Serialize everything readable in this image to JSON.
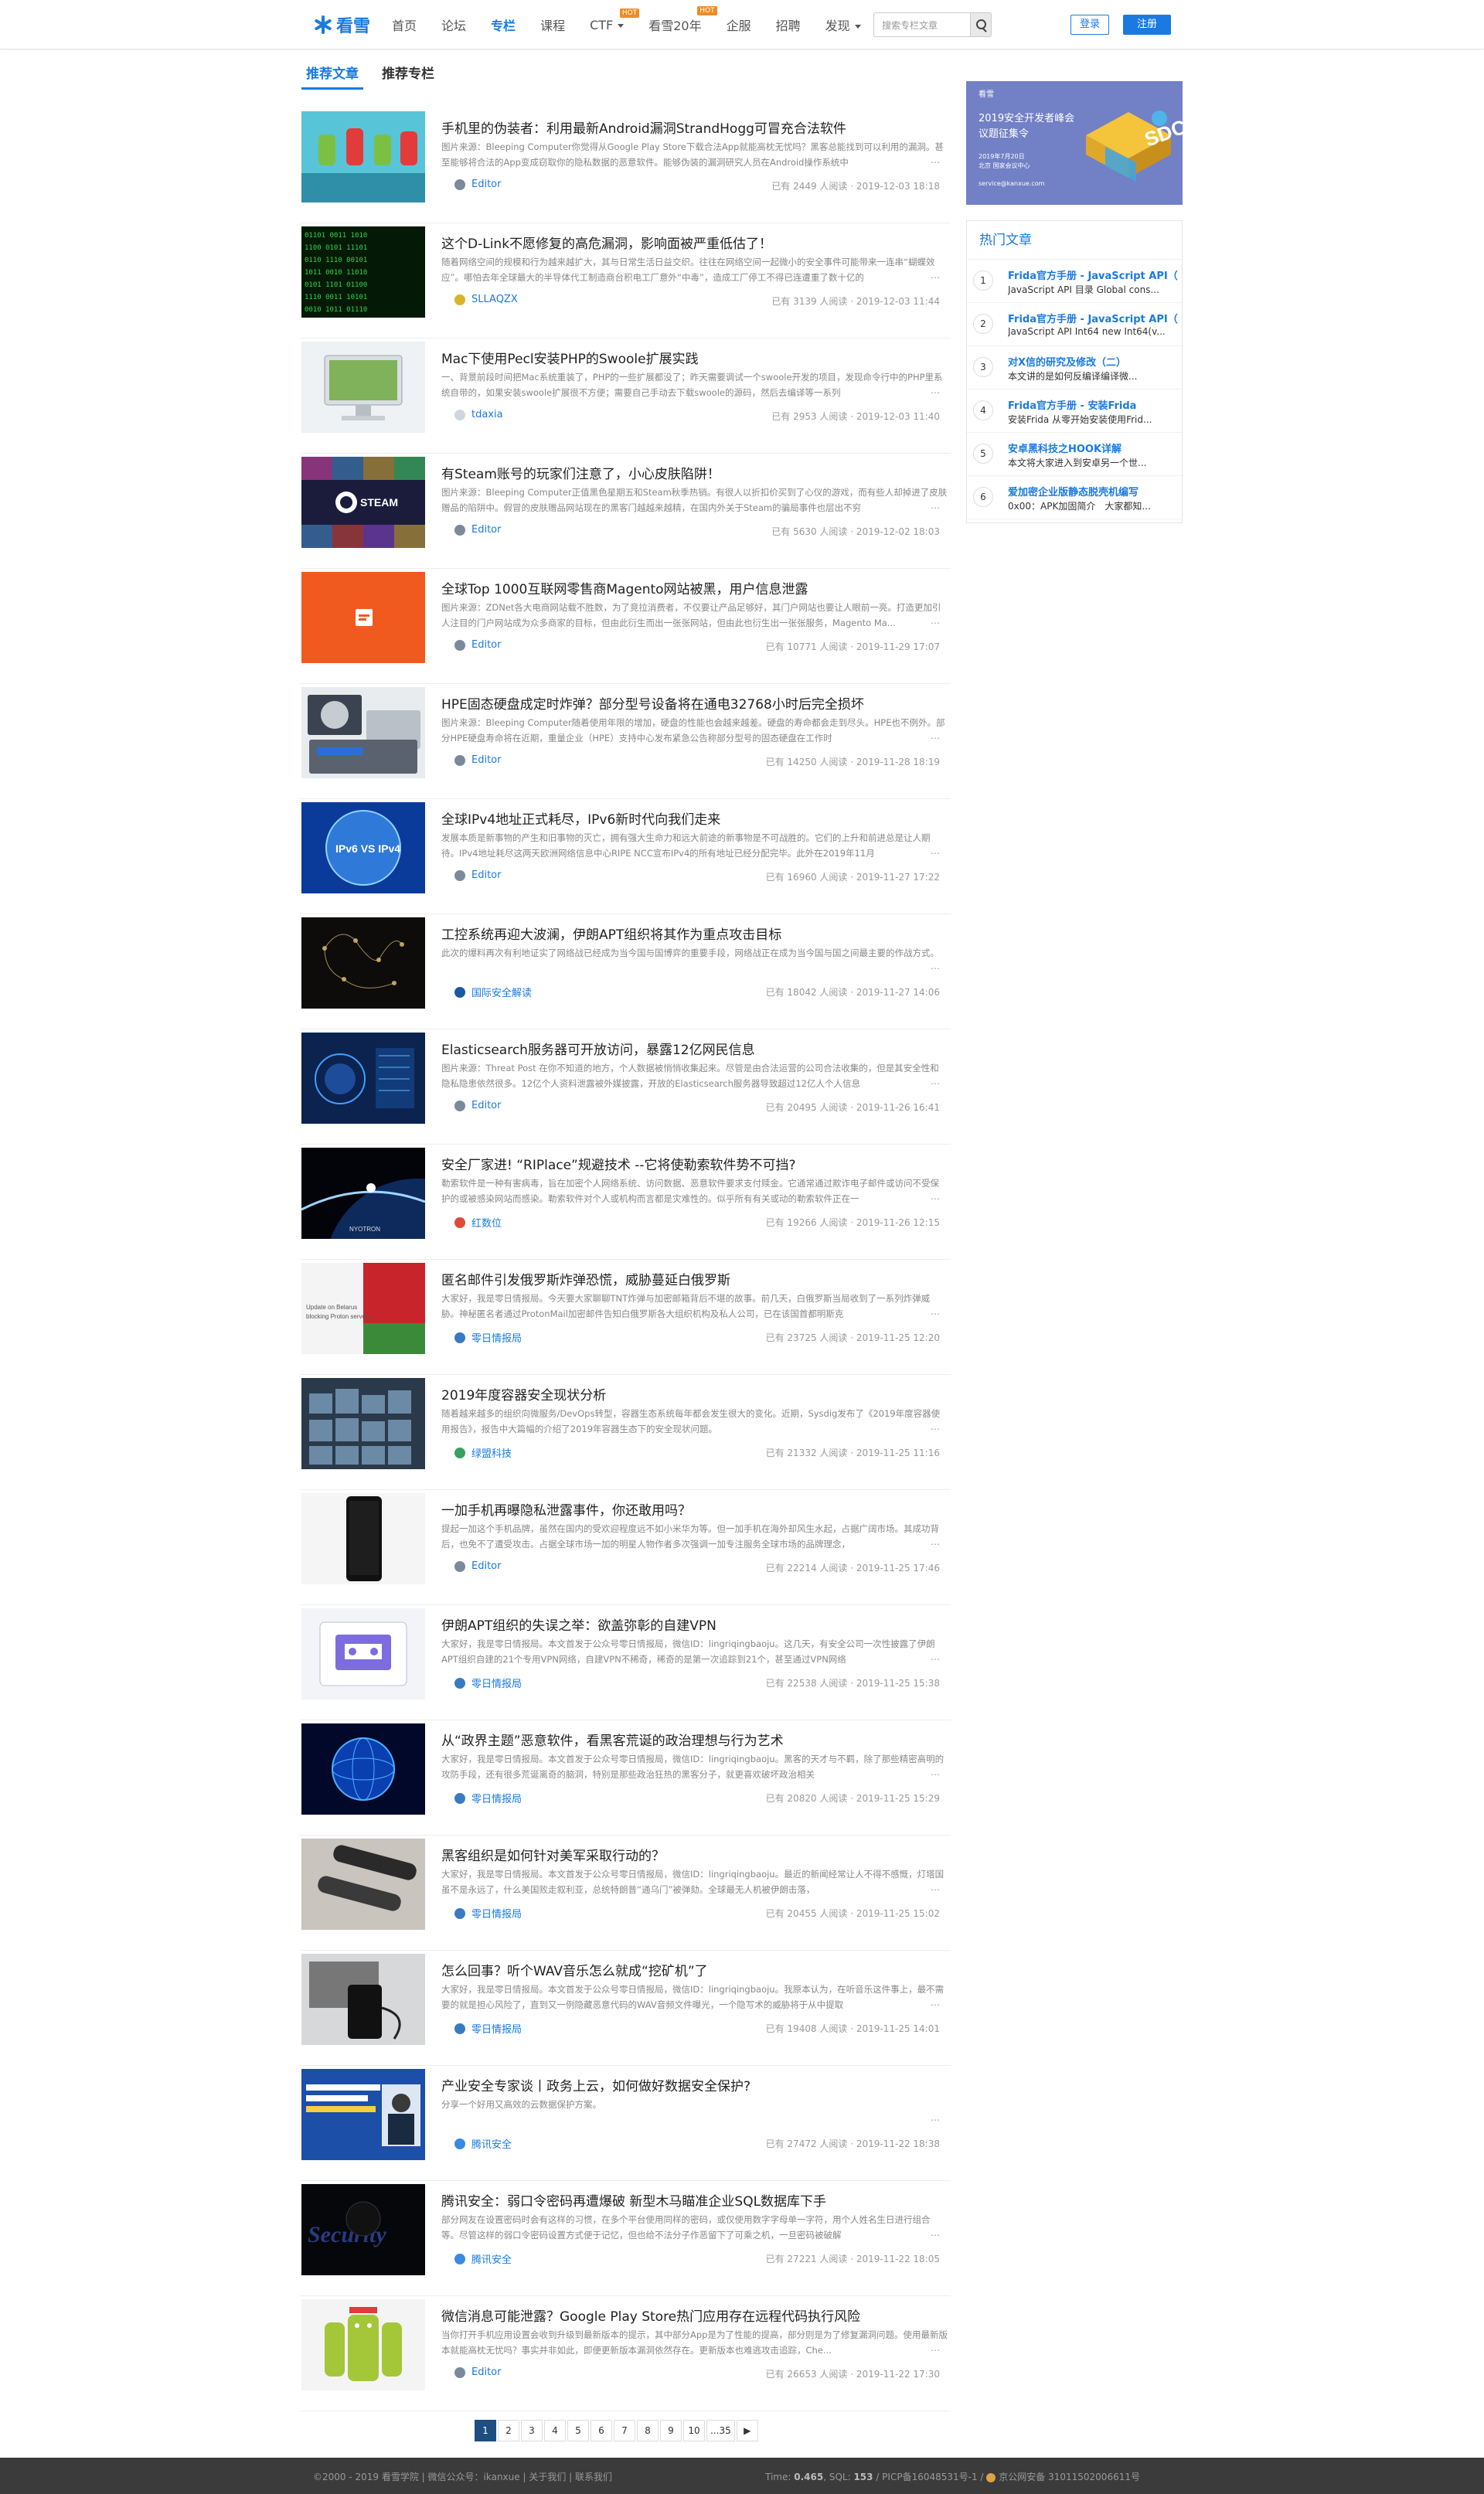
{
  "nav": {
    "logo": "看雪",
    "items": [
      {
        "label": "首页"
      },
      {
        "label": "论坛"
      },
      {
        "label": "专栏",
        "active": true
      },
      {
        "label": "课程"
      },
      {
        "label": "CTF",
        "hot": "HOT",
        "dropdown": true
      },
      {
        "label": "看雪20年",
        "hot": "HOT"
      },
      {
        "label": "企服"
      },
      {
        "label": "招聘"
      },
      {
        "label": "发现",
        "dropdown": true
      }
    ],
    "search_placeholder": "搜索专栏文章",
    "login": "登录",
    "register": "注册"
  },
  "tabs": [
    "推荐文章",
    "推荐专栏"
  ],
  "articles": [
    {
      "title": "手机里的伪装者：利用最新Android漏洞StrandHogg可冒充合法软件",
      "summary": "图片来源：Bleeping Computer你觉得从Google Play Store下载合法App就能高枕无忧吗？黑客总能找到可以利用的漏洞。甚至能够将合法的App变成窃取你的隐私数据的恶意软件。能够伪装的漏洞研究人员在Android操作系统中",
      "author": "Editor",
      "meta": "已有 2449 人阅读 · 2019-12-03 18:18"
    },
    {
      "title": "这个D-Link不愿修复的高危漏洞，影响面被严重低估了！",
      "summary": "随着网络空间的规模和行为越来越扩大，其与日常生活日益交织。往往在网络空间一起微小的安全事件可能带来一连串“蝴蝶效应”。哪怕去年全球最大的半导体代工制造商台积电工厂意外“中毒”，造成工厂停工不得已连遭重了数十亿的",
      "author": "SLLAQZX",
      "meta": "已有 3139 人阅读 · 2019-12-03 11:44"
    },
    {
      "title": "Mac下使用Pecl安装PHP的Swoole扩展实践",
      "summary": "一、背景前段时间把Mac系统重装了，PHP的一些扩展都没了；昨天需要调试一个swoole开发的项目，发现命令行中的PHP里系统自带的，如果安装swoole扩展很不方便；需要自己手动去下载swoole的源码，然后去编译等一系列",
      "author": "tdaxia",
      "meta": "已有 2953 人阅读 · 2019-12-03 11:40"
    },
    {
      "title": "有Steam账号的玩家们注意了，小心皮肤陷阱！",
      "summary": "图片来源：Bleeping Computer正值黑色星期五和Steam秋季热销。有很人以折扣价买到了心仪的游戏，而有些人却掉进了皮肤赠品的陷阱中。假冒的皮肤赠品网站现在的黑客门越越来越精，在国内外关于Steam的骗局事件也层出不穷",
      "author": "Editor",
      "meta": "已有 5630 人阅读 · 2019-12-02 18:03"
    },
    {
      "title": "全球Top 1000互联网零售商Magento网站被黑，用户信息泄露",
      "summary": "图片来源：ZDNet各大电商网站载不胜数，为了竞拉消费者，不仅要让产品足够好，其门户网站也要让人眼前一亮。打造更加引人注目的门户网站成为众多商家的目标，但由此衍生而出一张张网站，但由此也衍生出一张张服务，Magento Ma...",
      "author": "Editor",
      "meta": "已有 10771 人阅读 · 2019-11-29 17:07"
    },
    {
      "title": "HPE固态硬盘成定时炸弹？部分型号设备将在通电32768小时后完全损坏",
      "summary": "图片来源：Bleeping Computer随着使用年限的增加，硬盘的性能也会越来越差。硬盘的寿命都会走到尽头。HPE也不例外。部分HPE硬盘寿命将在近期，重量企业（HPE）支持中心发布紧急公告称部分型号的固态硬盘在工作时",
      "author": "Editor",
      "meta": "已有 14250 人阅读 · 2019-11-28 18:19"
    },
    {
      "title": "全球IPv4地址正式耗尽，IPv6新时代向我们走来",
      "summary": "发展本质是新事物的产生和旧事物的灭亡，拥有强大生命力和远大前途的新事物是不可战胜的。它们的上升和前进总是让人期待。IPv4地址耗尽这两天欧洲网络信息中心RIPE NCC宣布IPv4的所有地址已经分配完毕。此外在2019年11月",
      "author": "Editor",
      "meta": "已有 16960 人阅读 · 2019-11-27 17:22"
    },
    {
      "title": "工控系统再迎大波澜，伊朗APT组织将其作为重点攻击目标",
      "summary": "此次的爆料再次有利地证实了网络战已经成为当今国与国博弈的重要手段，网络战正在成为当今国与国之间最主要的作战方式。",
      "author": "国际安全解读",
      "meta": "已有 18042 人阅读 · 2019-11-27 14:06"
    },
    {
      "title": "Elasticsearch服务器可开放访问，暴露12亿网民信息",
      "summary": "图片来源：Threat Post 在你不知道的地方，个人数据被悄悄收集起来。尽管是由合法运营的公司合法收集的，但是其安全性和隐私隐患依然很多。12亿个人资料泄露被外媒披露，开放的Elasticsearch服务器导致超过12亿人个人信息",
      "author": "Editor",
      "meta": "已有 20495 人阅读 · 2019-11-26 16:41"
    },
    {
      "title": "安全厂家进! “RIPlace”规避技术 --它将使勒索软件势不可挡?",
      "summary": "勒索软件是一种有害病毒，旨在加密个人网络系统、访问数据、恶意软件要求支付赎金。它通常通过欺诈电子邮件或访问不受保护的或被感染网站而感染。勒索软件对个人或机构而言都是灾难性的。似乎所有有关或动的勒索软件正在一",
      "author": "红数位",
      "meta": "已有 19266 人阅读 · 2019-11-26 12:15"
    },
    {
      "title": "匿名邮件引发俄罗斯炸弹恐慌，威胁蔓延白俄罗斯",
      "summary": "大家好，我是零日情报局。今天要大家聊聊TNT炸弹与加密邮箱背后不堪的故事。前几天，白俄罗斯当局收到了一系列炸弹威胁。神秘匿名者通过ProtonMail加密邮件告知白俄罗斯各大组织机构及私人公司，已在该国首都明斯克",
      "author": "零日情报局",
      "meta": "已有 23725 人阅读 · 2019-11-25 12:20"
    },
    {
      "title": "2019年度容器安全现状分析",
      "summary": "随着越来越多的组织向微服务/DevOps转型，容器生态系统每年都会发生很大的变化。近期，Sysdig发布了《2019年度容器使用报告》，报告中大篇幅的介绍了2019年容器生态下的安全现状问题。",
      "author": "绿盟科技",
      "meta": "已有 21332 人阅读 · 2019-11-25 11:16"
    },
    {
      "title": "一加手机再曝隐私泄露事件，你还敢用吗？",
      "summary": "提起一加这个手机品牌，虽然在国内的受欢迎程度远不如小米华为等。但一加手机在海外却风生水起，占据广阔市场。其成功背后，也免不了遭受攻击。占据全球市场一加的明星人物作者多次强调一加专注服务全球市场的品牌理念，",
      "author": "Editor",
      "meta": "已有 22214 人阅读 · 2019-11-25 17:46"
    },
    {
      "title": "伊朗APT组织的失误之举：欲盖弥彰的自建VPN",
      "summary": "大家好，我是零日情报局。本文首发于公众号零日情报局，微信ID：lingriqingbaoju。这几天，有安全公司一次性披露了伊朗APT组织自建的21个专用VPN网络，自建VPN不稀奇，稀奇的是第一次追踪到21个，甚至通过VPN网络",
      "author": "零日情报局",
      "meta": "已有 22538 人阅读 · 2019-11-25 15:38"
    },
    {
      "title": "从“政界主题”恶意软件，看黑客荒诞的政治理想与行为艺术",
      "summary": "大家好，我是零日情报局。本文首发于公众号零日情报局，微信ID：lingriqingbaoju。黑客的天才与不羁，除了那些精密高明的攻防手段，还有很多荒诞离奇的脑洞，特别是那些政治狂热的黑客分子，就更喜欢破坏政治相关",
      "author": "零日情报局",
      "meta": "已有 20820 人阅读 · 2019-11-25 15:29"
    },
    {
      "title": "黑客组织是如何针对美军采取行动的？",
      "summary": "大家好，我是零日情报局。本文首发于公众号零日情报局，微信ID：lingriqingbaoju。最近的新闻经常让人不得不感慨，灯塔国虽不是永远了，什么美国败走叙利亚，总统特朗普“通乌门”被弹劾。全球最无人机被伊朗击落，",
      "author": "零日情报局",
      "meta": "已有 20455 人阅读 · 2019-11-25 15:02"
    },
    {
      "title": "怎么回事？听个WAV音乐怎么就成“挖矿机”了",
      "summary": "大家好，我是零日情报局。本文首发于公众号零日情报局，微信ID：lingriqingbaoju。我原本认为，在听音乐这件事上，最不需要的就是担心风险了，直到又一例隐藏恶意代码的WAV音频文件曝光，一个隐写术的威胁将于从中提取",
      "author": "零日情报局",
      "meta": "已有 19408 人阅读 · 2019-11-25 14:01"
    },
    {
      "title": "产业安全专家谈丨政务上云，如何做好数据安全保护?",
      "summary": "分享一个好用又高效的云数据保护方案。",
      "author": "腾讯安全",
      "meta": "已有 27472 人阅读 · 2019-11-22 18:38"
    },
    {
      "title": "腾讯安全：弱口令密码再遭爆破 新型木马瞄准企业SQL数据库下手",
      "summary": "部分网友在设置密码时会有这样的习惯，在多个平台使用同样的密码，或仅使用数字字母单一字符，用个人姓名生日进行组合等。尽管这样的弱口令密码设置方式便于记忆，但也给不法分子作恶留下了可乘之机，一旦密码被破解",
      "author": "腾讯安全",
      "meta": "已有 27221 人阅读 · 2019-11-22 18:05"
    },
    {
      "title": "微信消息可能泄露？Google Play Store热门应用存在远程代码执行风险",
      "summary": "当你打开手机应用设置会收到升级到最新版本的提示，其中部分App是为了性能的提高，部分则是为了修复漏洞问题。使用最新版本就能高枕无忧吗？事实并非如此，即便更新版本漏洞依然存在。更新版本也难逃攻击追踪，Che...",
      "author": "Editor",
      "meta": "已有 26653 人阅读 · 2019-11-22 17:30"
    }
  ],
  "sidebar": {
    "banner": {
      "brand": "看雪",
      "title_line1": "2019安全开发者峰会",
      "title_line2": "议题征集令",
      "date": "2019年7月20日",
      "place": "北京 国家会议中心",
      "email": "service@kanxue.com",
      "logo_text": "SDC"
    },
    "hot_title": "热门文章",
    "hot": [
      {
        "num": "1",
        "title": "Frida官方手册 - JavaScript API（",
        "sub": "JavaScript API 目录 Global cons..."
      },
      {
        "num": "2",
        "title": "Frida官方手册 - JavaScript API（",
        "sub": "JavaScript API Int64 new Int64(v..."
      },
      {
        "num": "3",
        "title": "对X信的研究及修改（二）",
        "sub": "本文讲的是如何反编译编译微..."
      },
      {
        "num": "4",
        "title": "Frida官方手册 - 安装Frida",
        "sub": "安装Frida 从零开始安装使用Frid..."
      },
      {
        "num": "5",
        "title": "安卓黑科技之HOOK详解",
        "sub": "本文将大家进入到安卓另一个世..."
      },
      {
        "num": "6",
        "title": "爱加密企业版静态脱壳机编写",
        "sub": "0x00：APK加固简介　大家都知..."
      }
    ]
  },
  "pager": [
    "1",
    "2",
    "3",
    "4",
    "5",
    "6",
    "7",
    "8",
    "9",
    "10",
    "...35",
    "▶"
  ],
  "footer": {
    "left": "©2000 - 2019 看雪学院 | 微信公众号：ikanxue | 关于我们 | 联系我们",
    "time_label": "Time: ",
    "time": "0.465",
    "sql_label": ", SQL: ",
    "sql": "153",
    "icp": " / PICP备16048531号-1 / ",
    "police": "京公网安备 31011502006611号"
  },
  "colors": {
    "accent": "#1a7ae0",
    "pager_active": "#1e4e80",
    "footer_bg": "#3b3b3b"
  }
}
